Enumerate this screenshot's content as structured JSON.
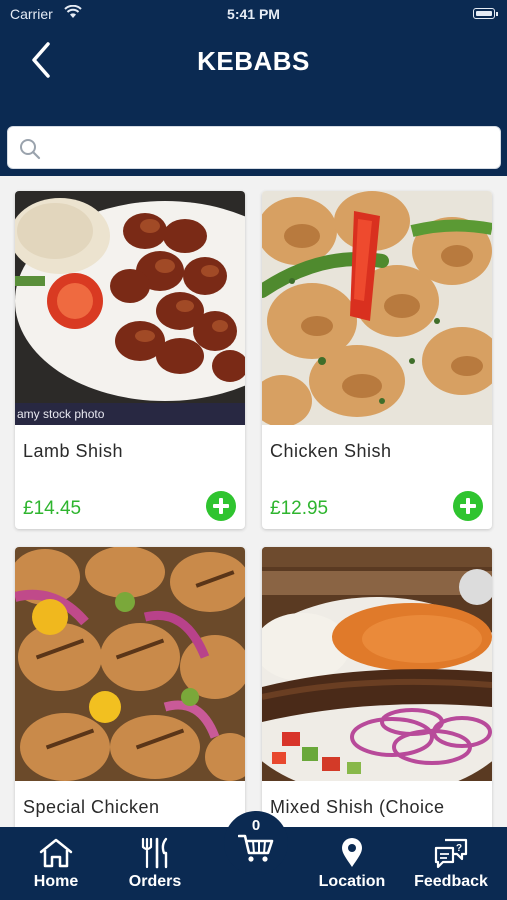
{
  "status_bar": {
    "carrier": "Carrier",
    "time": "5:41 PM"
  },
  "header": {
    "title": "KEBABS",
    "back_icon": "chevron-left-icon"
  },
  "search": {
    "placeholder": "",
    "value": "",
    "icon": "search-icon"
  },
  "products": [
    {
      "name": "Lamb Shish",
      "price": "£14.45",
      "watermark": "amy stock photo"
    },
    {
      "name": "Chicken Shish",
      "price": "£12.95"
    },
    {
      "name": "Special Chicken",
      "price": ""
    },
    {
      "name": "Mixed Shish (Choice",
      "price": ""
    }
  ],
  "tab_bar": {
    "home": "Home",
    "orders": "Orders",
    "cart_count": "0",
    "location": "Location",
    "feedback": "Feedback"
  },
  "colors": {
    "primary": "#0b2a52",
    "accent_green": "#2fc42f",
    "price_green": "#2fb52f",
    "background": "#f2f2f2"
  }
}
